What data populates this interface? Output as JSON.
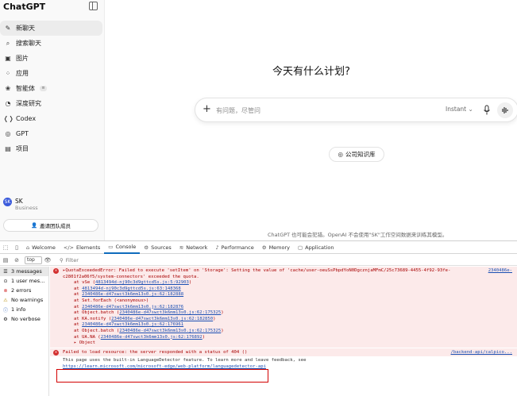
{
  "sidebar": {
    "brand": "ChatGPT",
    "items": [
      {
        "icon": "✎",
        "label": "新聊天"
      },
      {
        "icon": "⌕",
        "label": "搜索聊天"
      },
      {
        "icon": "▣",
        "label": "图片"
      },
      {
        "icon": "⁘",
        "label": "应用"
      },
      {
        "icon": "❀",
        "label": "智能体",
        "badge": "≡"
      },
      {
        "icon": "◔",
        "label": "深度研究"
      },
      {
        "icon": "❬❭",
        "label": "Codex"
      },
      {
        "icon": "◎",
        "label": "GPT"
      },
      {
        "icon": "▤",
        "label": "项目"
      }
    ],
    "profile": {
      "initials": "SK",
      "name": "SK",
      "plan": "Business"
    },
    "invite_label": "邀请团队成员"
  },
  "main": {
    "headline": "今天有什么计划?",
    "composer_placeholder": "有问题，尽管问",
    "model_label": "Instant ⌄",
    "kb_button": "公司知识库",
    "disclaimer": "ChatGPT 也可能会犯错。OpenAI 不会使用\"SK\"工作空间数据来训练其模型。"
  },
  "devtools": {
    "tabs": [
      {
        "icon": "⌂",
        "label": "Welcome"
      },
      {
        "icon": "</>",
        "label": "Elements"
      },
      {
        "icon": "▭",
        "label": "Console"
      },
      {
        "icon": "⚙",
        "label": "Sources"
      },
      {
        "icon": "≋",
        "label": "Network"
      },
      {
        "icon": "♪",
        "label": "Performance"
      },
      {
        "icon": "⚙",
        "label": "Memory"
      },
      {
        "icon": "▢",
        "label": "Application"
      }
    ],
    "context": "top",
    "filter_placeholder": "Filter",
    "sidebar": [
      {
        "icon": "☰",
        "label": "3 messages"
      },
      {
        "icon": "⊙",
        "label": "1 user mes..."
      },
      {
        "icon": "⊗",
        "label": "2 errors"
      },
      {
        "icon": "⚠",
        "label": "No warnings"
      },
      {
        "icon": "ⓘ",
        "label": "1 info"
      },
      {
        "icon": "⚙",
        "label": "No verbose"
      }
    ],
    "error1": {
      "lines": [
        "▸QuotaExceededError: Failed to execute 'setItem' on 'Storage': Setting the value of 'cache/user-oeuSsPbpdYoN0DgcznjaMFmC/25c73689-4455-4f92-93fe-",
        "c2801f2a06f5/system-connectors' exceeded the quota."
      ],
      "source": "2340486e-",
      "stack": [
        {
          "fn": "at vSe (",
          "loc": "4813494d-nj90c3d9gttcd5s.js:5:92903",
          "end": ")"
        },
        {
          "fn": "at ",
          "loc": "4813494d-nj90c3d9gttcd5s.js:63:148368",
          "end": ""
        },
        {
          "fn": "at ",
          "loc": "2340486e-d47swct3k6mm13s0.js:62:182888",
          "end": ""
        },
        {
          "fn": "at Set.forEach (<anonymous>)",
          "loc": "",
          "end": ""
        },
        {
          "fn": "at ",
          "loc": "2340486e-d47swct3k6mm13s0.js:62:182876",
          "end": ""
        },
        {
          "fn": "at Object.batch (",
          "loc": "2340486e-d47swct3k6mm13s0.js:62:175325",
          "end": ")"
        },
        {
          "fn": "at KA.notify (",
          "loc": "2340486e-d47swct3k6mm13s0.js:62:182850",
          "end": ")"
        },
        {
          "fn": "at ",
          "loc": "2340486e-d47swct3k6mm13s0.js:62:176961",
          "end": ""
        },
        {
          "fn": "at Object.batch (",
          "loc": "2340486e-d47swct3k6mm13s0.js:62:175325",
          "end": ")"
        },
        {
          "fn": "at UA.NA (",
          "loc": "2340486e-d47swct3k6mm13s0.js:62:176892",
          "end": ")"
        },
        {
          "fn": "▸ Object",
          "loc": "",
          "end": ""
        }
      ]
    },
    "error2": {
      "text": "Failed to load resource: the server responded with a status of 404 ()",
      "source": "/backend-api/calpico..."
    },
    "info": {
      "text": "This page uses the built-in LanguageDetector feature. To learn more and leave feedback, see",
      "link": "https://learn.microsoft.com/microsoft-edge/web-platform/languagedetector-api"
    }
  },
  "colors": {
    "accent": "#0f6cbd",
    "error_bg": "#fceaea",
    "error_text": "#a80000",
    "highlight": "#d30000"
  }
}
